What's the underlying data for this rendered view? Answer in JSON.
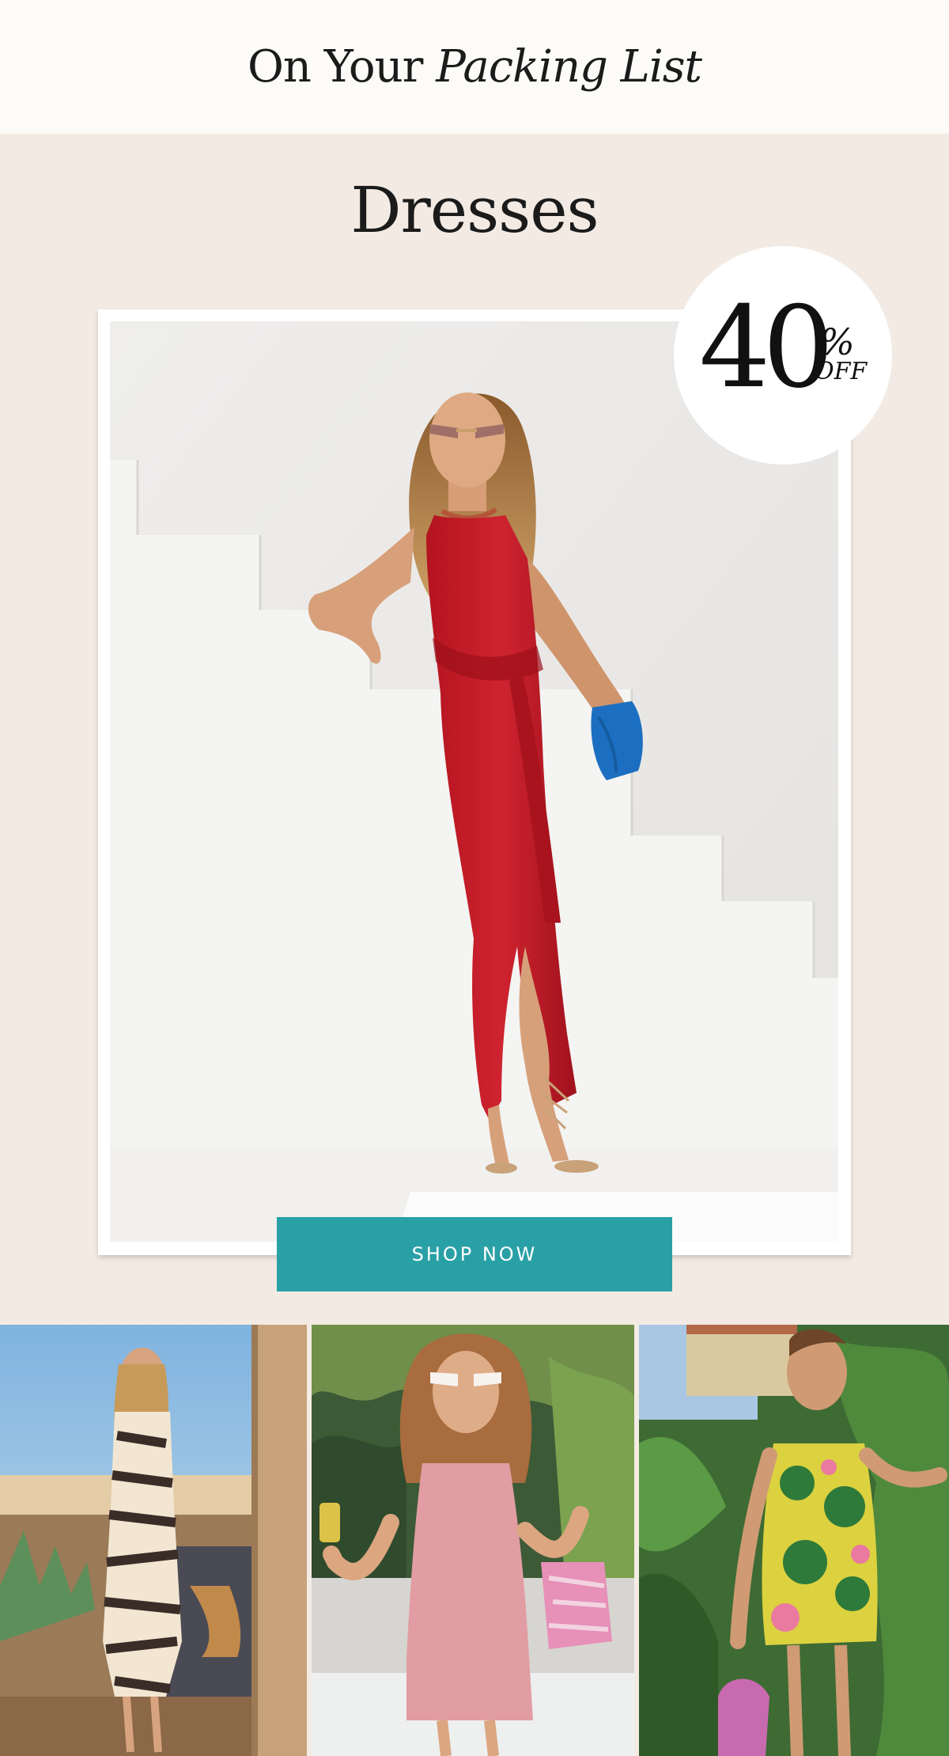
{
  "header": {
    "title_plain": "On Your ",
    "title_italic": "Packing List"
  },
  "section": {
    "title": "Dresses"
  },
  "badge": {
    "number": "40",
    "percent": "%",
    "off": "OFF"
  },
  "cta": {
    "label": "SHOP NOW"
  },
  "colors": {
    "accent": "#29a0a6",
    "background": "#f3ebe3",
    "header_background": "#fcfbf8",
    "dress_red": "#c21d2b"
  },
  "gallery": {
    "items": [
      {
        "icon": "zebra-print-dress-photo"
      },
      {
        "icon": "pink-dress-photo"
      },
      {
        "icon": "tropical-print-dress-photo"
      }
    ]
  }
}
